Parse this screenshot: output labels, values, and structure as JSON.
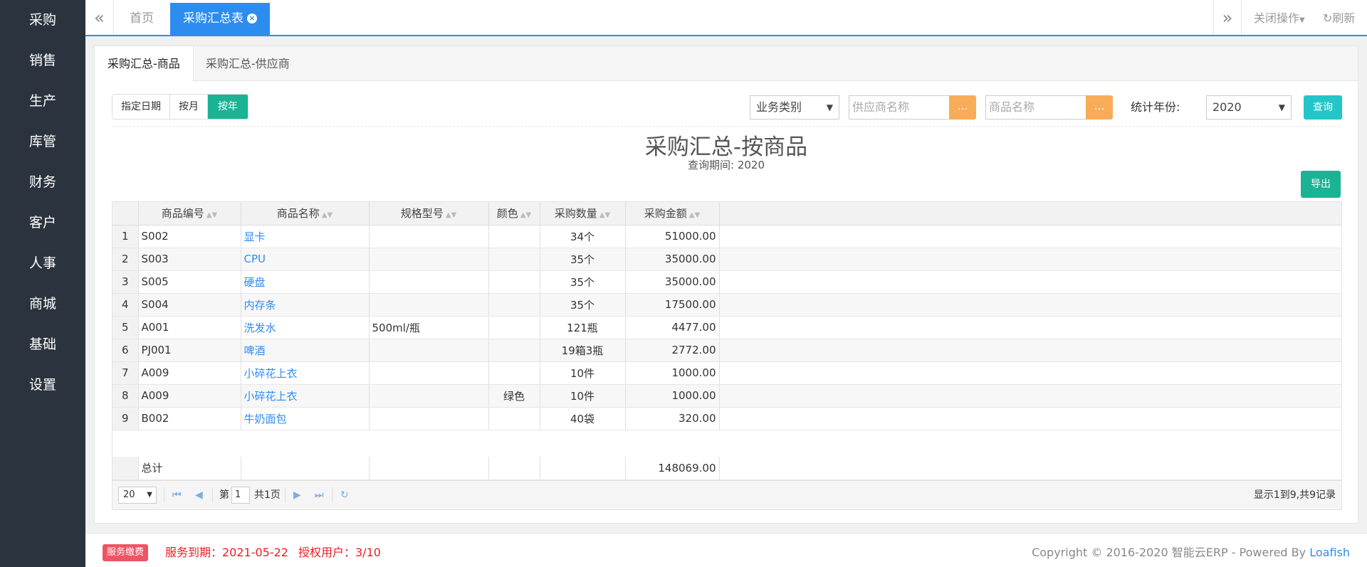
{
  "sidebar": {
    "items": [
      "采购",
      "销售",
      "生产",
      "库管",
      "财务",
      "客户",
      "人事",
      "商城",
      "基础",
      "设置"
    ]
  },
  "topbar": {
    "home_tab": "首页",
    "active_tab": "采购汇总表",
    "close_ops": "关闭操作",
    "refresh": "刷新"
  },
  "subtabs": [
    "采购汇总-商品",
    "采购汇总-供应商"
  ],
  "filters": {
    "date_buttons": [
      "指定日期",
      "按月",
      "按年"
    ],
    "business_type": "业务类别",
    "supplier_placeholder": "供应商名称",
    "product_placeholder": "商品名称",
    "year_label": "统计年份:",
    "year_value": "2020",
    "query": "查询",
    "dots": "..."
  },
  "report": {
    "title": "采购汇总-按商品",
    "period": "查询期间:  2020",
    "export": "导出"
  },
  "table": {
    "headers": [
      "商品编号",
      "商品名称",
      "规格型号",
      "颜色",
      "采购数量",
      "采购金额"
    ],
    "rows": [
      [
        "1",
        "S002",
        "显卡",
        "",
        "",
        "34个",
        "51000.00"
      ],
      [
        "2",
        "S003",
        "CPU",
        "",
        "",
        "35个",
        "35000.00"
      ],
      [
        "3",
        "S005",
        "硬盘",
        "",
        "",
        "35个",
        "35000.00"
      ],
      [
        "4",
        "S004",
        "内存条",
        "",
        "",
        "35个",
        "17500.00"
      ],
      [
        "5",
        "A001",
        "洗发水",
        "500ml/瓶",
        "",
        "121瓶",
        "4477.00"
      ],
      [
        "6",
        "PJ001",
        "啤酒",
        "",
        "",
        "19箱3瓶",
        "2772.00"
      ],
      [
        "7",
        "A009",
        "小碎花上衣",
        "",
        "",
        "10件",
        "1000.00"
      ],
      [
        "8",
        "A009",
        "小碎花上衣",
        "",
        "绿色",
        "10件",
        "1000.00"
      ],
      [
        "9",
        "B002",
        "牛奶面包",
        "",
        "",
        "40袋",
        "320.00"
      ]
    ],
    "total_label": "总计",
    "total_amount": "148069.00"
  },
  "pager": {
    "page_size": "20",
    "page_prefix": "第",
    "page_value": "1",
    "page_suffix": "共1页",
    "info": "显示1到9,共9记录"
  },
  "footer": {
    "badge": "服务缴费",
    "expire": "服务到期：2021-05-22",
    "users": "授权用户：3/10",
    "copyright": "Copyright © 2016-2020 智能云ERP - Powered By ",
    "powered": "Loafish"
  }
}
